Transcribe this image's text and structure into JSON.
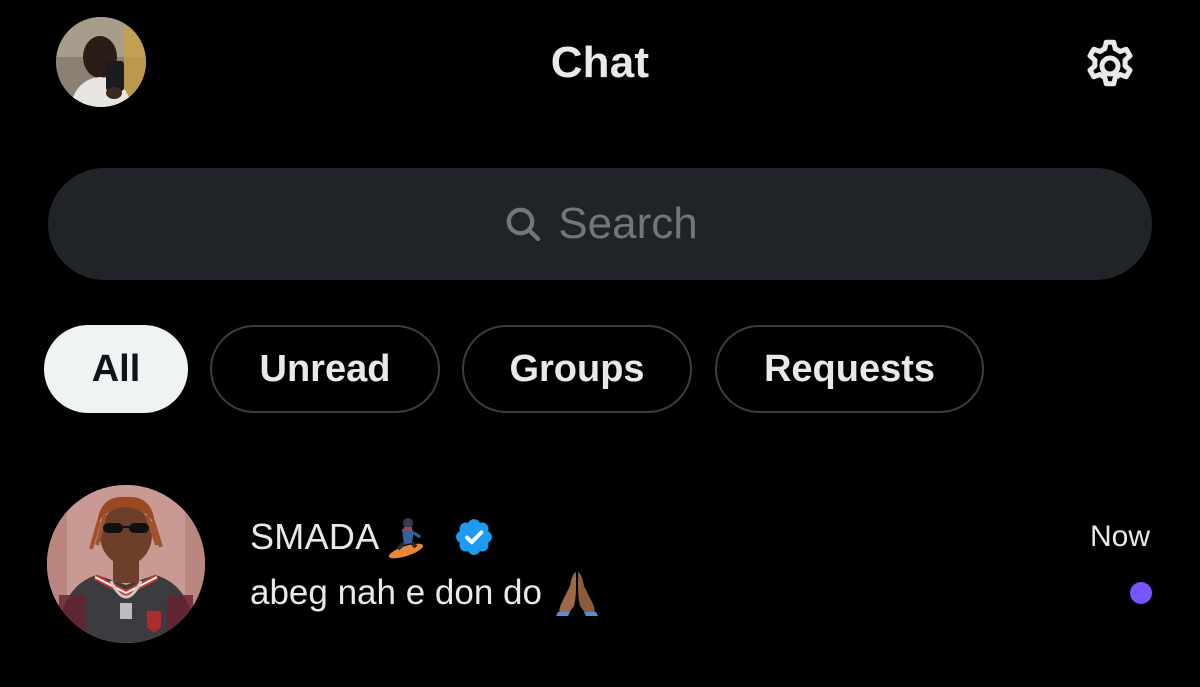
{
  "header": {
    "title": "Chat",
    "avatar_icon": "profile-avatar",
    "settings_icon": "gear-icon"
  },
  "search": {
    "placeholder": "Search",
    "icon": "search-icon"
  },
  "filters": [
    {
      "label": "All",
      "active": true
    },
    {
      "label": "Unread",
      "active": false
    },
    {
      "label": "Groups",
      "active": false
    },
    {
      "label": "Requests",
      "active": false
    }
  ],
  "conversations": [
    {
      "name": "SMADA",
      "name_emoji": "snowboarder-emoji",
      "verified": true,
      "message": "abeg nah e don do",
      "message_emoji": "folded-hands-emoji",
      "time": "Now",
      "unread": true
    }
  ],
  "colors": {
    "background": "#000000",
    "search_bg": "#202327",
    "chip_active_bg": "#eff3f4",
    "verified_blue": "#1d9bf0",
    "unread_dot": "#7856ff",
    "muted_text": "#71767b"
  }
}
